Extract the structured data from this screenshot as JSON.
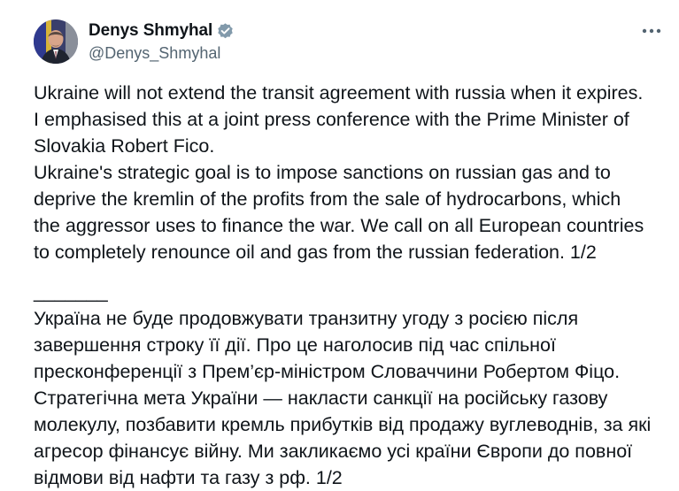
{
  "author": {
    "display_name": "Denys Shmyhal",
    "handle": "@Denys_Shmyhal",
    "verified": true,
    "verified_color": "#829aab"
  },
  "menu": {
    "icon": "more-horizontal-icon"
  },
  "tweet": {
    "lines_en": [
      "Ukraine will not extend the transit agreement with russia when it expires.",
      "I emphasised this at a joint press conference with the Prime Minister of",
      "Slovakia Robert Fico.",
      "Ukraine's strategic goal is to impose sanctions on russian gas and to",
      "deprive the kremlin of the profits from the sale of hydrocarbons, which",
      "the aggressor uses to finance the war. We call on all European countries",
      "to completely renounce oil and gas from the russian federation. 1/2"
    ],
    "separator": "_______",
    "lines_uk": [
      "Україна не буде продовжувати транзитну угоду з росією після",
      "завершення строку її дії. Про це наголосив під час спільної",
      "пресконференції з Прем’єр-міністром Словаччини Робертом Фіцо.",
      "Стратегічна мета України — накласти санкції на російську газову",
      "молекулу, позбавити кремль прибутків від продажу вуглеводнів, за які",
      "агресор фінансує війну. Ми закликаємо усі країни Європи до повної",
      "відмови від нафти та газу з рф. 1/2"
    ]
  }
}
